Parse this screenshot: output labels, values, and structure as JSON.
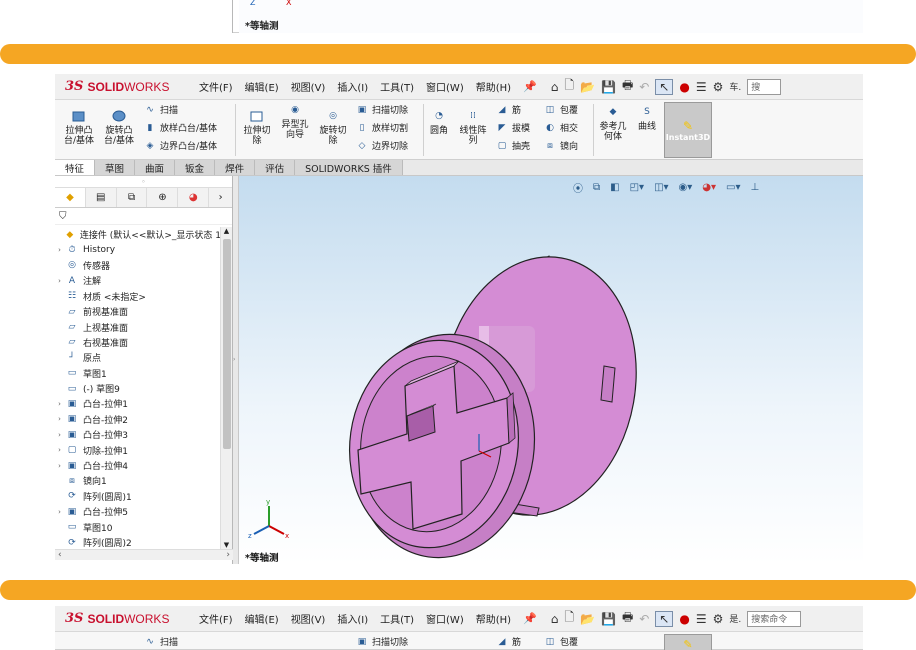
{
  "colors": {
    "orange": "#f5a623",
    "part": "#d98cd9",
    "part_dark": "#b866b8",
    "viewport_top": "#c4dcef"
  },
  "top_crop": {
    "view_label": "*等轴测"
  },
  "app": {
    "logo": {
      "ds": "3S",
      "solid": "SOLID",
      "works": "WORKS"
    },
    "menu": [
      "文件(F)",
      "编辑(E)",
      "视图(V)",
      "插入(I)",
      "工具(T)",
      "窗口(W)",
      "帮助(H)"
    ],
    "quick_access": [
      "home-icon",
      "new-doc-icon",
      "open-icon",
      "save-icon",
      "print-icon",
      "undo-icon",
      "select-icon",
      "traffic-light-icon",
      "options-icon",
      "settings-icon"
    ],
    "search_text": "搜",
    "search_text_2": "搜索命令",
    "truncated_menu": "车.",
    "truncated_menu_2": "是."
  },
  "ribbon": {
    "extrude_boss": "拉伸凸\n台/基体",
    "revolve_boss": "旋转凸\n台/基体",
    "sweep": "扫描",
    "loft": "放样凸台/基体",
    "boundary_boss": "边界凸台/基体",
    "extrude_cut": "拉伸切\n除",
    "hole_wizard": "异型孔\n向导",
    "revolve_cut": "旋转切\n除",
    "swept_cut": "扫描切除",
    "lofted_cut": "放样切割",
    "boundary_cut": "边界切除",
    "fillet": "圆角",
    "linear_pattern": "线性阵\n列",
    "rib": "筋",
    "draft": "拔模",
    "shell": "抽壳",
    "wrap": "包覆",
    "intersect": "相交",
    "mirror": "镜向",
    "ref_geometry": "参考几\n何体",
    "curves": "曲线",
    "instant3d": "Instant3D"
  },
  "tabs": [
    "特征",
    "草图",
    "曲面",
    "钣金",
    "焊件",
    "评估",
    "SOLIDWORKS 插件"
  ],
  "feature_tree": [
    {
      "arrow": "",
      "icon": "assembly-icon",
      "label": "连接件 (默认<<默认>_显示状态 1"
    },
    {
      "arrow": "›",
      "icon": "history-icon",
      "label": "History"
    },
    {
      "arrow": "",
      "icon": "sensor-icon",
      "label": "传感器"
    },
    {
      "arrow": "›",
      "icon": "annotation-icon",
      "label": "注解"
    },
    {
      "arrow": "",
      "icon": "material-icon",
      "label": "材质 <未指定>"
    },
    {
      "arrow": "",
      "icon": "plane-icon",
      "label": "前视基准面"
    },
    {
      "arrow": "",
      "icon": "plane-icon",
      "label": "上视基准面"
    },
    {
      "arrow": "",
      "icon": "plane-icon",
      "label": "右视基准面"
    },
    {
      "arrow": "",
      "icon": "origin-icon",
      "label": "原点"
    },
    {
      "arrow": "",
      "icon": "sketch-icon",
      "label": "草图1"
    },
    {
      "arrow": "",
      "icon": "sketch-icon",
      "label": "(-) 草图9"
    },
    {
      "arrow": "›",
      "icon": "boss-extrude-icon",
      "label": "凸台-拉伸1"
    },
    {
      "arrow": "›",
      "icon": "boss-extrude-icon",
      "label": "凸台-拉伸2"
    },
    {
      "arrow": "›",
      "icon": "boss-extrude-icon",
      "label": "凸台-拉伸3"
    },
    {
      "arrow": "›",
      "icon": "cut-extrude-icon",
      "label": "切除-拉伸1"
    },
    {
      "arrow": "›",
      "icon": "boss-extrude-icon",
      "label": "凸台-拉伸4"
    },
    {
      "arrow": "",
      "icon": "mirror-icon",
      "label": "镜向1"
    },
    {
      "arrow": "",
      "icon": "circular-pattern-icon",
      "label": "阵列(圆周)1"
    },
    {
      "arrow": "›",
      "icon": "boss-extrude-icon",
      "label": "凸台-拉伸5"
    },
    {
      "arrow": "",
      "icon": "sketch-icon",
      "label": "草图10"
    },
    {
      "arrow": "",
      "icon": "circular-pattern-icon",
      "label": "阵列(圆周)2"
    }
  ],
  "viewport": {
    "view_label": "*等轴测"
  },
  "bottom_ribbon": {
    "sweep": "扫描",
    "swept_cut": "扫描切除",
    "rib": "筋",
    "wrap": "包覆"
  }
}
